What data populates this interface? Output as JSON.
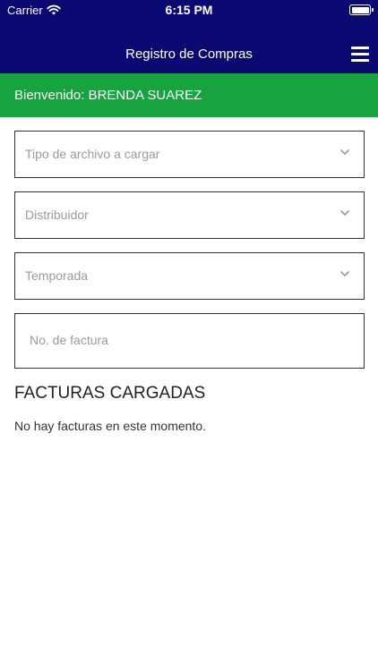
{
  "status_bar": {
    "carrier": "Carrier",
    "time": "6:15 PM"
  },
  "nav": {
    "title": "Registro de Compras"
  },
  "welcome": {
    "text": "Bienvenido: BRENDA SUAREZ"
  },
  "form": {
    "tipo_archivo": {
      "placeholder": "Tipo de archivo a cargar"
    },
    "distribuidor": {
      "placeholder": "Distribuidor"
    },
    "temporada": {
      "placeholder": "Temporada"
    },
    "factura": {
      "placeholder": "No. de factura"
    }
  },
  "invoices": {
    "title": "FACTURAS CARGADAS",
    "empty_message": "No hay facturas en este momento."
  },
  "colors": {
    "nav_bg": "#0a0a72",
    "welcome_bg": "#16a340"
  }
}
